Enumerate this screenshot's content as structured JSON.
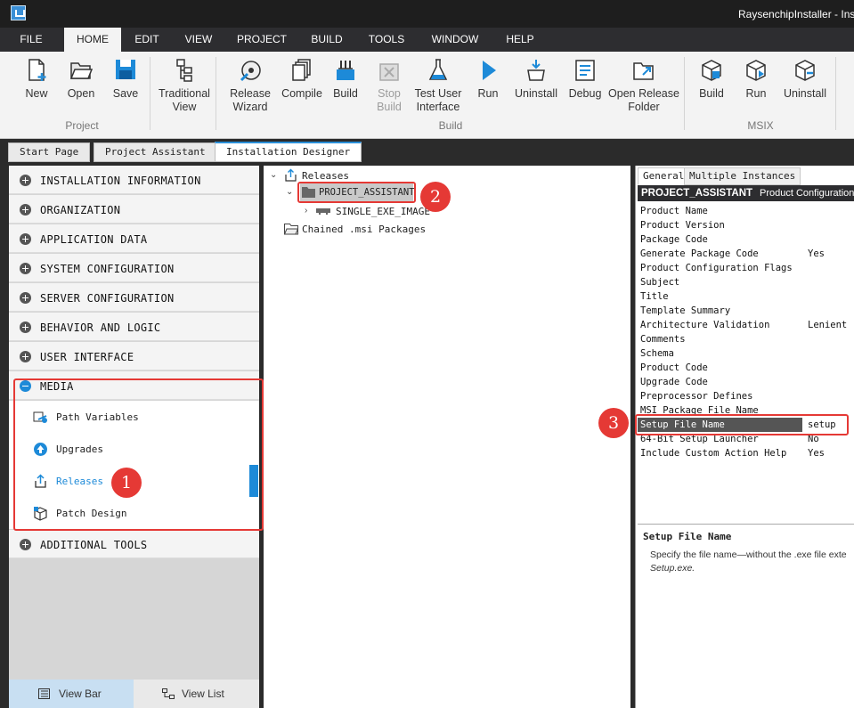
{
  "window": {
    "title": "RaysenchipInstaller - Inst"
  },
  "menu": [
    "FILE",
    "HOME",
    "EDIT",
    "VIEW",
    "PROJECT",
    "BUILD",
    "TOOLS",
    "WINDOW",
    "HELP"
  ],
  "ribbon": {
    "new": "New",
    "open": "Open",
    "save": "Save",
    "traditional_view_1": "Traditional",
    "traditional_view_2": "View",
    "release_wizard_1": "Release",
    "release_wizard_2": "Wizard",
    "compile": "Compile",
    "build": "Build",
    "stop_build_1": "Stop",
    "stop_build_2": "Build",
    "test_ui_1": "Test User",
    "test_ui_2": "Interface",
    "run": "Run",
    "uninstall": "Uninstall",
    "debug": "Debug",
    "open_release_1": "Open Release",
    "open_release_2": "Folder",
    "msix_build": "Build",
    "msix_run": "Run",
    "msix_uninstall": "Uninstall",
    "group_project": "Project",
    "group_build": "Build",
    "group_msix": "MSIX"
  },
  "doc_tabs": [
    "Start Page",
    "Project Assistant",
    "Installation Designer"
  ],
  "sidebar": {
    "categories": [
      "INSTALLATION INFORMATION",
      "ORGANIZATION",
      "APPLICATION DATA",
      "SYSTEM CONFIGURATION",
      "SERVER CONFIGURATION",
      "BEHAVIOR AND LOGIC",
      "USER INTERFACE",
      "MEDIA",
      "ADDITIONAL TOOLS"
    ],
    "media_items": [
      "Path Variables",
      "Upgrades",
      "Releases",
      "Patch Design"
    ],
    "view_bar": "View Bar",
    "view_list": "View List"
  },
  "tree": {
    "root": "Releases",
    "project": "PROJECT_ASSISTANT",
    "image": "SINGLE_EXE_IMAGE",
    "chained": "Chained .msi Packages"
  },
  "props": {
    "tabs": [
      "General",
      "Multiple Instances"
    ],
    "header_name": "PROJECT_ASSISTANT",
    "header_desc": "Product Configuration",
    "rows": [
      {
        "name": "Product Name",
        "value": ""
      },
      {
        "name": "Product Version",
        "value": ""
      },
      {
        "name": "Package Code",
        "value": ""
      },
      {
        "name": "Generate Package Code",
        "value": "Yes"
      },
      {
        "name": "Product Configuration Flags",
        "value": ""
      },
      {
        "name": "Subject",
        "value": ""
      },
      {
        "name": "Title",
        "value": ""
      },
      {
        "name": "Template Summary",
        "value": ""
      },
      {
        "name": "Architecture Validation",
        "value": "Lenient"
      },
      {
        "name": "Comments",
        "value": ""
      },
      {
        "name": "Schema",
        "value": ""
      },
      {
        "name": "Product Code",
        "value": ""
      },
      {
        "name": "Upgrade Code",
        "value": ""
      },
      {
        "name": "Preprocessor Defines",
        "value": ""
      },
      {
        "name": "MSI Package File Name",
        "value": ""
      },
      {
        "name": "Setup File Name",
        "value": "setup"
      },
      {
        "name": "64-Bit Setup Launcher",
        "value": "No"
      },
      {
        "name": "Include Custom Action Help",
        "value": "Yes"
      }
    ],
    "desc_title": "Setup File Name",
    "desc_line1": "Specify the file name—without the .exe file exte",
    "desc_line2": "Setup.exe."
  },
  "annotations": [
    "1",
    "2",
    "3"
  ],
  "colors": {
    "accent": "#1d8ad8",
    "annotation": "#e53935",
    "menubar": "#2d2d30"
  }
}
